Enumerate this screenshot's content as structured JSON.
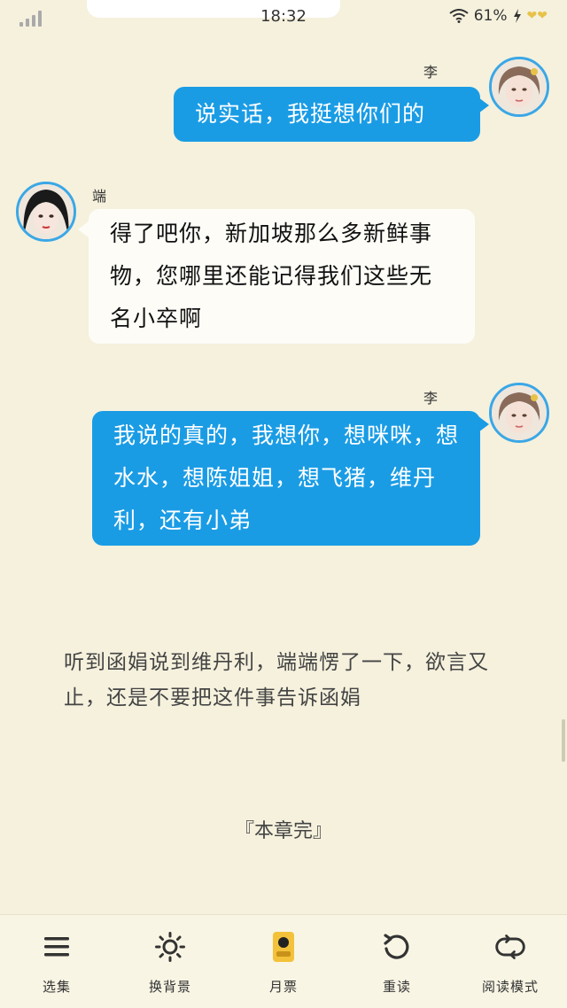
{
  "status_bar": {
    "time": "18:32",
    "battery": "61%"
  },
  "messages": [
    {
      "sender": "李函娟",
      "side": "right",
      "text": "说实话，我挺想你们的"
    },
    {
      "sender": "端端",
      "side": "left",
      "text": "得了吧你，新加坡那么多新鲜事物，您哪里还能记得我们这些无名小卒啊"
    },
    {
      "sender": "李函娟",
      "side": "right",
      "text": "我说的真的，我想你，想咪咪，想水水，想陈姐姐，想飞猪，维丹利，还有小弟"
    }
  ],
  "narration": "听到函娟说到维丹利，端端愣了一下，欲言又止，还是不要把这件事告诉函娟",
  "chapter_end": "『本章完』",
  "toolbar": [
    {
      "label": "选集",
      "icon": "menu-icon"
    },
    {
      "label": "换背景",
      "icon": "sun-icon"
    },
    {
      "label": "月票",
      "icon": "ticket-icon"
    },
    {
      "label": "重读",
      "icon": "reload-icon"
    },
    {
      "label": "阅读模式",
      "icon": "mode-switch-icon"
    }
  ],
  "colors": {
    "background": "#f5f1dd",
    "bubble_right": "#1a9ce5",
    "bubble_left": "#fdfcf7",
    "avatar_ring": "#3aa7e6",
    "ticket": "#f3c23a"
  }
}
